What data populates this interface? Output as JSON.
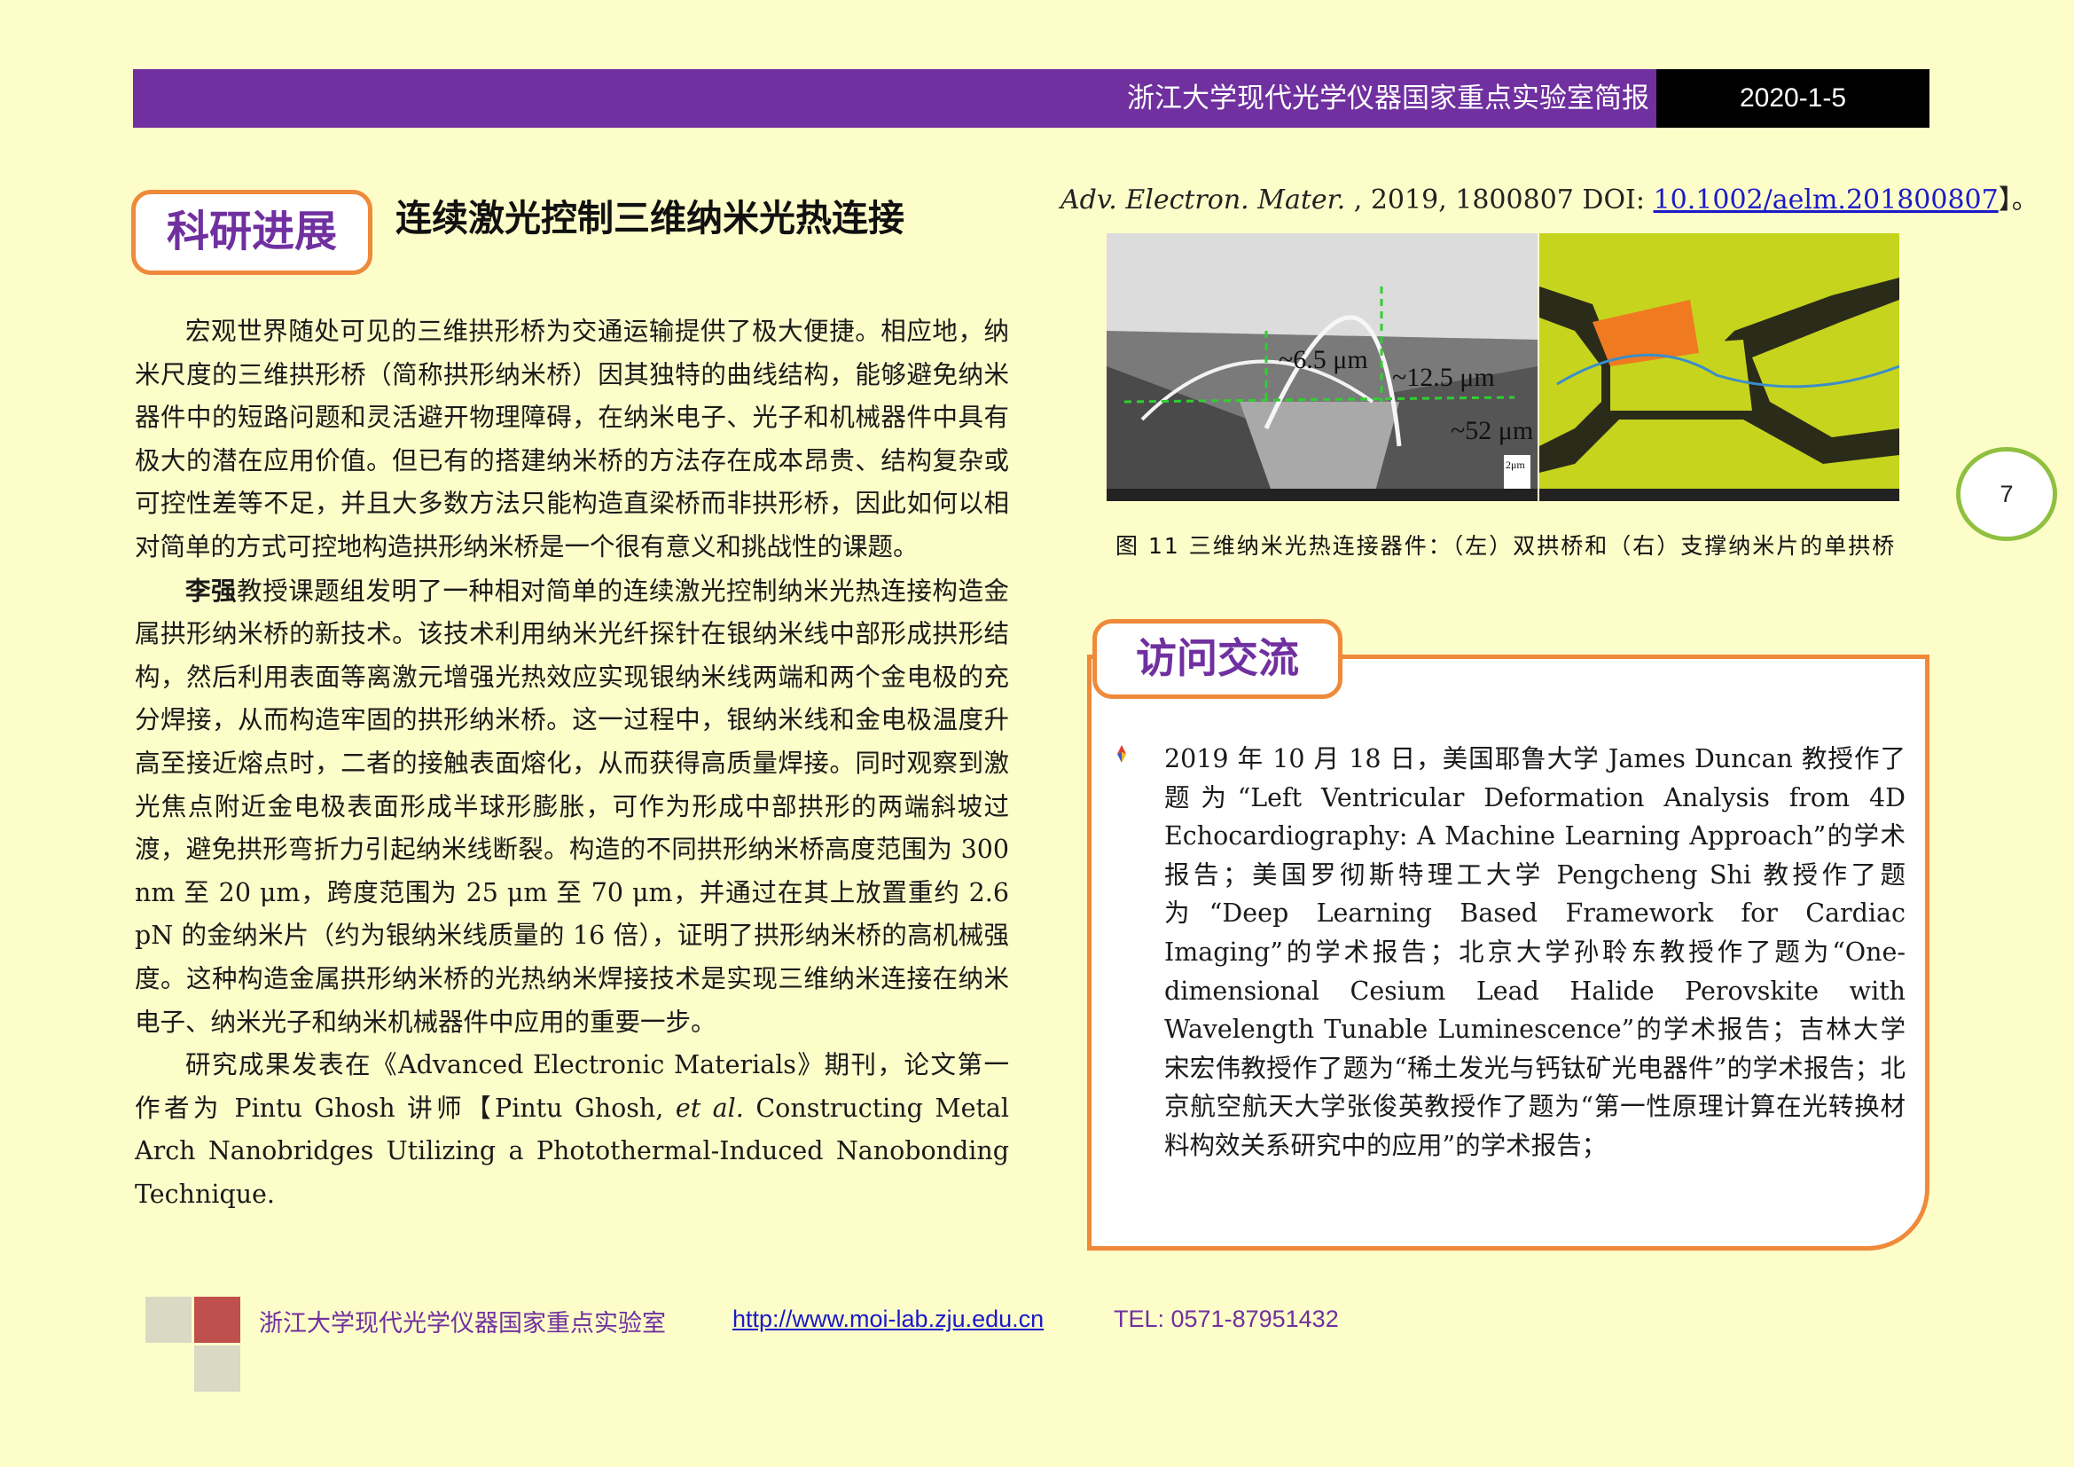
{
  "header": {
    "title": "浙江大学现代光学仪器国家重点实验室简报",
    "date": "2020-1-5"
  },
  "research": {
    "tag": "科研进展",
    "title": "连续激光控制三维纳米光热连接",
    "paragraph1": "宏观世界随处可见的三维拱形桥为交通运输提供了极大便捷。相应地，纳米尺度的三维拱形桥（简称拱形纳米桥）因其独特的曲线结构，能够避免纳米器件中的短路问题和灵活避开物理障碍，在纳米电子、光子和机械器件中具有极大的潜在应用价值。但已有的搭建纳米桥的方法存在成本昂贵、结构复杂或可控性差等不足，并且大多数方法只能构造直梁桥而非拱形桥，因此如何以相对简单的方式可控地构造拱形纳米桥是一个很有意义和挑战性的课题。",
    "paragraph2_name": "李强",
    "paragraph2_rest": "教授课题组发明了一种相对简单的连续激光控制纳米光热连接构造金属拱形纳米桥的新技术。该技术利用纳米光纤探针在银纳米线中部形成拱形结构，然后利用表面等离激元增强光热效应实现银纳米线两端和两个金电极的充分焊接，从而构造牢固的拱形纳米桥。这一过程中，银纳米线和金电极温度升高至接近熔点时，二者的接触表面熔化，从而获得高质量焊接。同时观察到激光焦点附近金电极表面形成半球形膨胀，可作为形成中部拱形的两端斜坡过渡，避免拱形弯折力引起纳米线断裂。构造的不同拱形纳米桥高度范围为 300 nm 至 20 μm，跨度范围为 25 μm 至 70 μm，并通过在其上放置重约 2.6 pN 的金纳米片（约为银纳米线质量的 16 倍），证明了拱形纳米桥的高机械强度。这种构造金属拱形纳米桥的光热纳米焊接技术是实现三维纳米连接在纳米电子、纳米光子和纳米机械器件中应用的重要一步。",
    "paragraph3_a": "研究成果发表在《Advanced Electronic Materials》期刊，论文第一作者为 Pintu Ghosh 讲师【Pintu Ghosh, ",
    "paragraph3_etal": "et al.",
    "paragraph3_b": " Constructing Metal Arch Nanobridges Utilizing a Photothermal-Induced Nanobonding Technique.",
    "citation_journal": "Adv. Electron. Mater.",
    "citation_mid": " , 2019, 1800807 DOI: ",
    "citation_doi": "10.1002/aelm.201800807",
    "citation_end": "】。"
  },
  "figure": {
    "label_height1": "~6.5 μm",
    "label_height2": "~12.5 μm",
    "label_span": "~52 μm",
    "scale_bar": "2μm",
    "caption": "图 11  三维纳米光热连接器件：（左）双拱桥和（右）支撑纳米片的单拱桥"
  },
  "page_number": "7",
  "visit": {
    "tag": "访问交流",
    "text": "2019 年 10 月 18 日，美国耶鲁大学 James Duncan 教授作了题为“Left Ventricular Deformation Analysis from 4D Echocardiography: A Machine Learning Approach”的学术报告；美国罗彻斯特理工大学 Pengcheng Shi 教授作了题为“Deep Learning Based Framework for Cardiac Imaging”的学术报告；北京大学孙聆东教授作了题为“One-dimensional Cesium Lead Halide Perovskite with Wavelength Tunable Luminescence”的学术报告；吉林大学宋宏伟教授作了题为“稀土发光与钙钛矿光电器件”的学术报告；北京航空航天大学张俊英教授作了题为“第一性原理计算在光转换材料构效关系研究中的应用”的学术报告；"
  },
  "footer": {
    "org": "浙江大学现代光学仪器国家重点实验室",
    "url": "http://www.moi-lab.zju.edu.cn",
    "tel": "TEL: 0571-87951432"
  },
  "colors": {
    "background": "#fdfdc9",
    "header_purple": "#7030a0",
    "accent_orange": "#ee8a3a",
    "page_circle_green": "#8fc040",
    "link_blue": "#1a1ac8"
  }
}
